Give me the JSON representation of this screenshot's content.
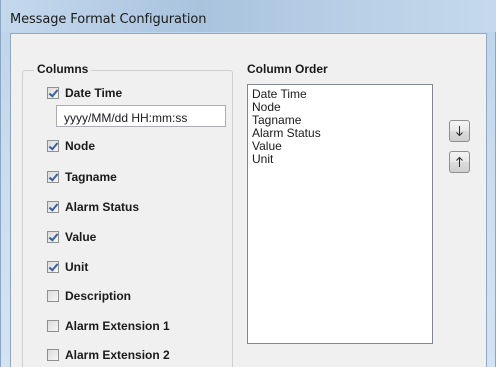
{
  "window": {
    "title": "Message Format Configuration"
  },
  "columns_group": {
    "title": "Columns",
    "items": [
      {
        "label": "Date Time",
        "checked": true
      },
      {
        "label": "Node",
        "checked": true
      },
      {
        "label": "Tagname",
        "checked": true
      },
      {
        "label": "Alarm Status",
        "checked": true
      },
      {
        "label": "Value",
        "checked": true
      },
      {
        "label": "Unit",
        "checked": true
      },
      {
        "label": "Description",
        "checked": false
      },
      {
        "label": "Alarm Extension 1",
        "checked": false
      },
      {
        "label": "Alarm Extension 2",
        "checked": false
      }
    ],
    "date_format": "yyyy/MM/dd HH:mm:ss"
  },
  "column_order": {
    "title": "Column Order",
    "items": [
      "Date Time",
      "Node",
      "Tagname",
      "Alarm Status",
      "Value",
      "Unit"
    ],
    "move_down_icon": "arrow-down-icon",
    "move_up_icon": "arrow-up-icon"
  }
}
